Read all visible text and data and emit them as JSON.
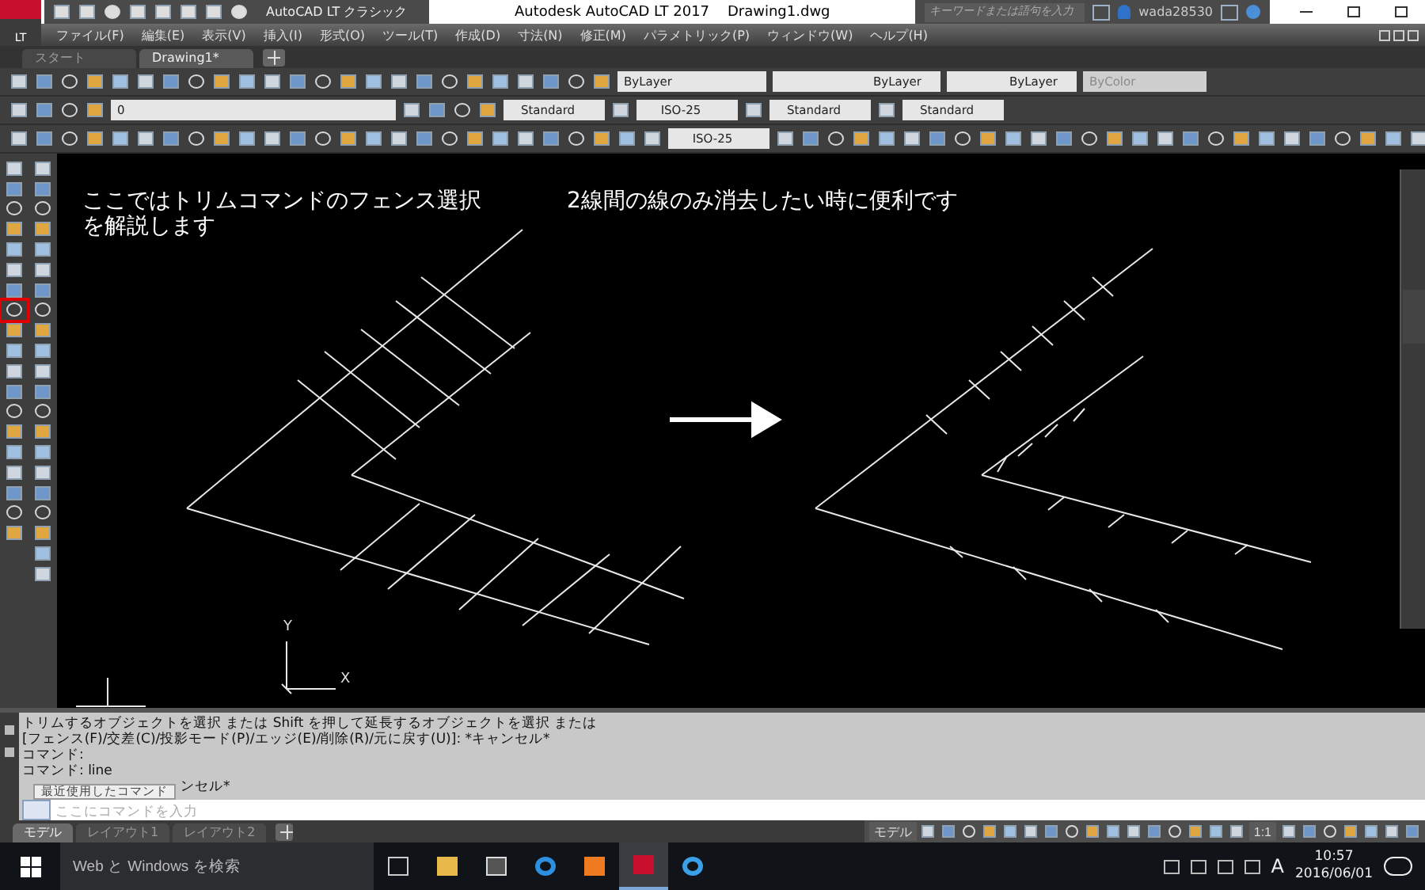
{
  "titlebar": {
    "app_badge": "LT",
    "workspace": "AutoCAD LT クラシック",
    "title": "Autodesk AutoCAD LT 2017    Drawing1.dwg",
    "search": {
      "placeholder": "キーワードまたは語句を入力"
    },
    "user": "wada28530"
  },
  "menu": [
    "ファイル(F)",
    "編集(E)",
    "表示(V)",
    "挿入(I)",
    "形式(O)",
    "ツール(T)",
    "作成(D)",
    "寸法(N)",
    "修正(M)",
    "パラメトリック(P)",
    "ウィンドウ(W)",
    "ヘルプ(H)"
  ],
  "doc_tabs": [
    {
      "label": "スタート",
      "selected": false
    },
    {
      "label": "Drawing1*",
      "selected": true
    }
  ],
  "toolbars": {
    "color_control": "ByLayer",
    "linetype": "ByLayer",
    "lineweight": "ByLayer",
    "plotstyle": {
      "value": "ByColor",
      "disabled": true
    },
    "layer": "0",
    "text_style": "Standard",
    "dim_style": "ISO-25",
    "table_style": "Standard",
    "mleader_style": "Standard",
    "dim_style_2": "ISO-25"
  },
  "canvas": {
    "notes": [
      {
        "lines": [
          "ここではトリムコマンドのフェンス選択",
          "を解説します"
        ]
      },
      {
        "lines": [
          "2線間の線のみ消去したい時に便利です"
        ]
      }
    ],
    "ucs": {
      "y": "Y",
      "x": "X"
    }
  },
  "command": {
    "history": [
      "トリムするオブジェクトを選択 または Shift を押して延長するオブジェクトを選択 または",
      "[フェンス(F)/交差(C)/投影モード(P)/エッジ(E)/削除(R)/元に戻す(U)]: *キャンセル*",
      "コマンド:",
      "コマンド:  line",
      "ンセル*"
    ],
    "tooltip": "最近使用したコマンド",
    "placeholder": "ここにコマンドを入力"
  },
  "layout_tabs": [
    {
      "label": "モデル",
      "selected": true
    },
    {
      "label": "レイアウト1",
      "selected": false
    },
    {
      "label": "レイアウト2",
      "selected": false
    }
  ],
  "status_bar": {
    "space": "モデル",
    "scale": "1:1"
  },
  "taskbar": {
    "search": {
      "placeholder": "Web と Windows を検索"
    },
    "ime": "A",
    "time": "10:57",
    "date": "2016/06/01"
  }
}
